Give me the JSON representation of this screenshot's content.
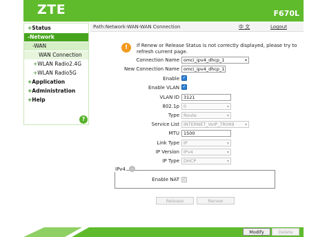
{
  "header": {
    "brand": "ZTE",
    "model": "F670L"
  },
  "sidebar": {
    "items": [
      {
        "label": "Status",
        "prefix": "+"
      },
      {
        "label": "Network",
        "prefix": "-"
      },
      {
        "label": "WAN",
        "prefix": "-"
      },
      {
        "label": "WAN Connection",
        "prefix": ""
      },
      {
        "label": "WLAN Radio2.4G",
        "prefix": "+"
      },
      {
        "label": "WLAN Radio5G",
        "prefix": "+"
      },
      {
        "label": "Application",
        "prefix": "+"
      },
      {
        "label": "Administration",
        "prefix": "+"
      },
      {
        "label": "Help",
        "prefix": "+"
      }
    ],
    "help_icon": "?"
  },
  "pathbar": {
    "path": "Path:Network-WAN-WAN Connection",
    "lang": "中 文",
    "logout": "Logout"
  },
  "notice": {
    "icon": "!",
    "text": "If Renew or Release Status is not correctly displayed, please try to refresh current page."
  },
  "form": {
    "connection_name_label": "Connection Name",
    "connection_name_value": "omci_ipv4_dhcp_1",
    "new_connection_name_label": "New Connection Name",
    "new_connection_name_value": "omci_ipv4_dhcp_1",
    "enable_label": "Enable",
    "enable_vlan_label": "Enable VLAN",
    "vlan_id_label": "VLAN ID",
    "vlan_id_value": "3121",
    "dot1p_label": "802.1p",
    "dot1p_value": "0",
    "type_label": "Type",
    "type_value": "Route",
    "service_list_label": "Service List",
    "service_list_value": "INTERNET_VoIP_TR069",
    "mtu_label": "MTU",
    "mtu_value": "1500",
    "link_type_label": "Link Type",
    "link_type_value": "IP",
    "ip_version_label": "IP Version",
    "ip_version_value": "IPv4",
    "ip_type_label": "IP Type",
    "ip_type_value": "DHCP",
    "ipv4_legend": "IPv4",
    "enable_nat_label": "Enable NAT",
    "checkmark": "✓"
  },
  "buttons": {
    "release": "Release",
    "renew": "Renew",
    "modify": "Modify",
    "delete": "Delete"
  },
  "icons": {
    "dropdown": "▾",
    "collapse": "−"
  },
  "colors": {
    "brand_green": "#5fbb2c",
    "active_green": "#47a51d",
    "checkbox_blue": "#2a7fd4",
    "warning_orange": "#f29a1d"
  }
}
